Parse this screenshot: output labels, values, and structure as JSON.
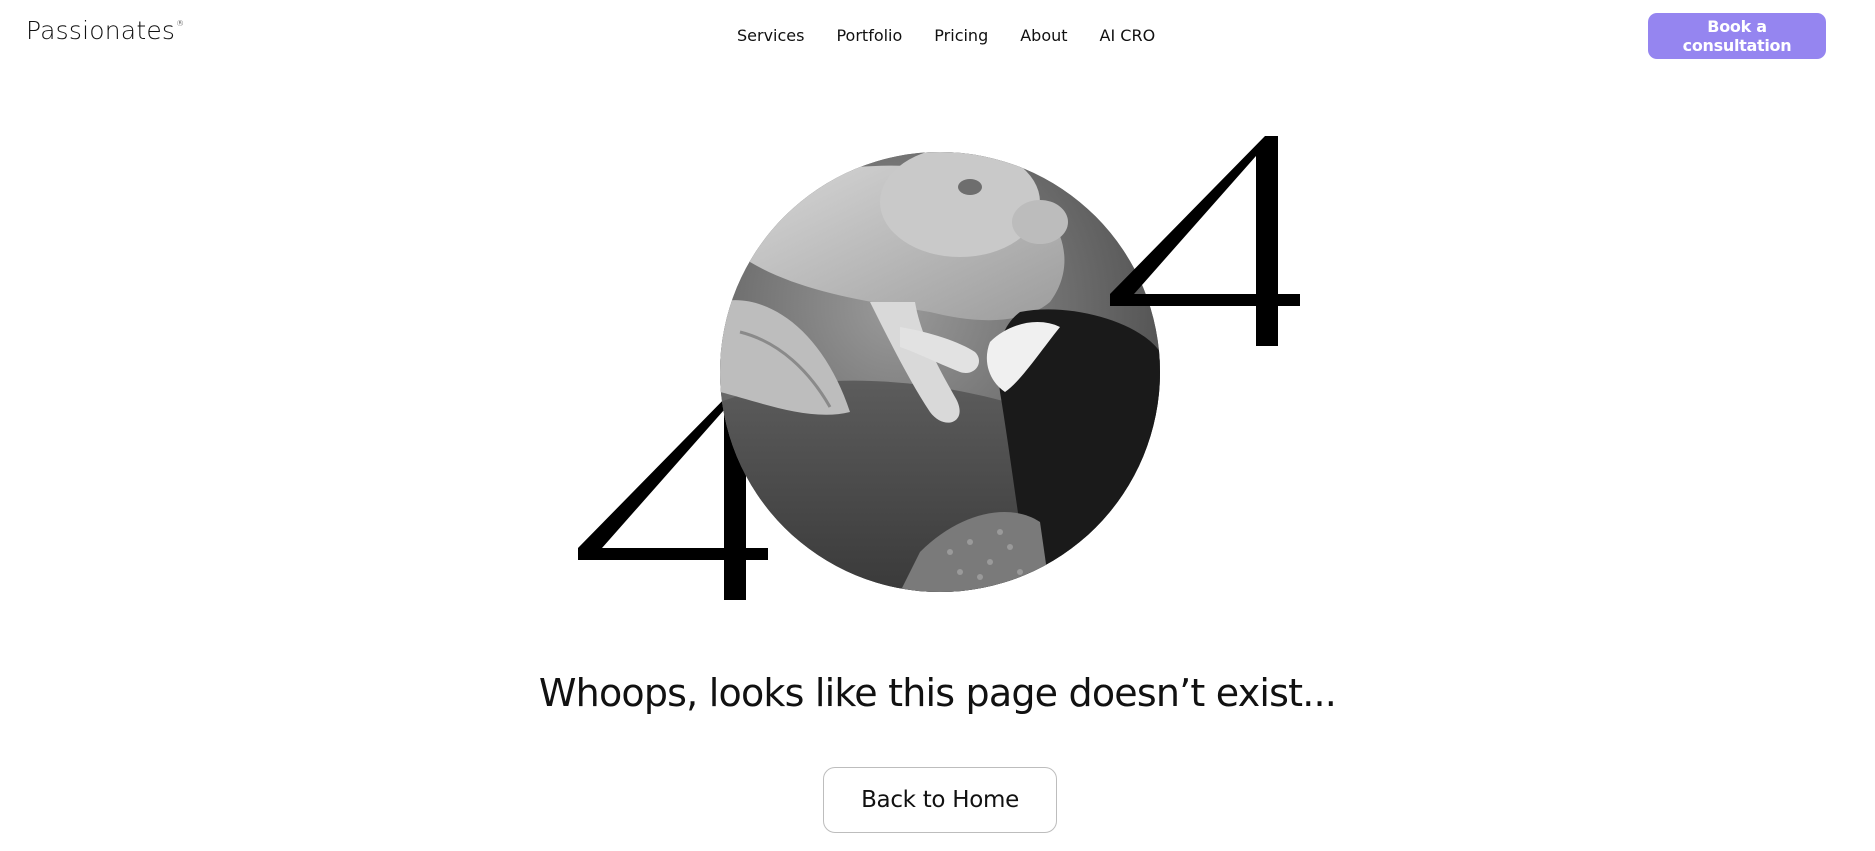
{
  "header": {
    "logo_text": "Passionates",
    "logo_mark": "®",
    "nav": [
      {
        "label": "Services"
      },
      {
        "label": "Portfolio"
      },
      {
        "label": "Pricing"
      },
      {
        "label": "About"
      },
      {
        "label": "AI CRO"
      }
    ],
    "cta_label": "Book a consultation",
    "cta_color": "#9585f0"
  },
  "error": {
    "digit_left": "4",
    "digit_right": "4",
    "image_description_icon": "dog-photo",
    "message": "Whoops, looks like this page doesn’t exist...",
    "back_label": "Back to Home"
  }
}
